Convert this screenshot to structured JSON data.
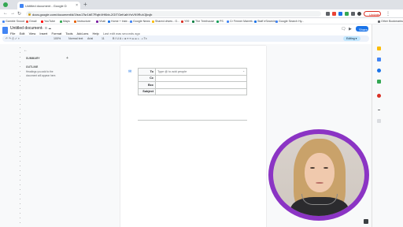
{
  "browser": {
    "tab_title": "Untitled document - Google D",
    "tab_close": "×",
    "new_tab": "+",
    "back": "←",
    "forward": "→",
    "reload": "↻",
    "url": "docs.google.com/document/d/1fsrc1Tsr1bE7Rqfr4HKbb-2GITGeKaIhYoVK9RuVJjkvjb",
    "update_label": "Update",
    "menu": "⋮"
  },
  "bookmarks": [
    {
      "label": "Gamble Snood",
      "color": "#4285f4"
    },
    {
      "label": "Gmail",
      "color": "#ea4335"
    },
    {
      "label": "YouTube",
      "color": "#ff0000"
    },
    {
      "label": "Maps",
      "color": "#34a853"
    },
    {
      "label": "Instructure",
      "color": "#e66000"
    },
    {
      "label": "Vhali",
      "color": "#7b1fa2"
    },
    {
      "label": "Home + Instr...",
      "color": "#1a73e8"
    },
    {
      "label": "Google News",
      "color": "#4285f4"
    },
    {
      "label": "Shared drives - G...",
      "color": "#fbbc04"
    },
    {
      "label": "Y99",
      "color": "#d93025"
    },
    {
      "label": "The Treehouse",
      "color": "#0b8043"
    },
    {
      "label": "PS",
      "color": "#0f9d58"
    },
    {
      "label": "Cr Fenner Marrett...",
      "color": "#4285f4"
    },
    {
      "label": "Staff eSearning",
      "color": "#1a73e8"
    },
    {
      "label": "Google Search Hy...",
      "color": "#4285f4"
    },
    {
      "label": "Other Bookmarks",
      "color": "#5f6368"
    }
  ],
  "docs": {
    "title": "Untitled document",
    "title_icons": "☆ ⊡ ☁",
    "menus": [
      "File",
      "Edit",
      "View",
      "Insert",
      "Format",
      "Tools",
      "Add-ons",
      "Help"
    ],
    "last_edit": "Last edit was seconds ago",
    "share_label": "Share",
    "editing_label": "Editing ▾",
    "toolbar": {
      "zoom": "100%",
      "style": "Normal text",
      "font": "Arial",
      "size": "11",
      "tools": "B  I  U  A  ⌕  ⊞  ≡  ≡  ☰  ☰  ⇤  ⇥  Tx"
    }
  },
  "outline": {
    "back": "←",
    "summary_label": "SUMMARY",
    "add": "+",
    "outline_label": "OUTLINE",
    "hint": "Headings you add to the document will appear here."
  },
  "email_draft": {
    "icon": "✉",
    "rows": [
      {
        "label": "To",
        "value": "Type @ to add people"
      },
      {
        "label": "Cc",
        "value": ""
      },
      {
        "label": "Bcc",
        "value": ""
      },
      {
        "label": "Subject",
        "value": ""
      }
    ]
  },
  "colors": {
    "accent": "#1a73e8",
    "webcam_ring": "#8b34c4",
    "update": "#d93025"
  }
}
